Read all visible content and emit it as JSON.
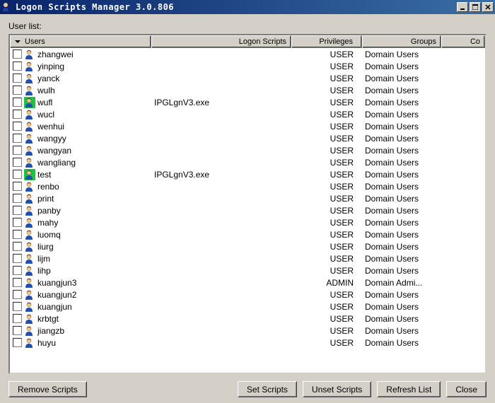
{
  "window": {
    "title": "Logon Scripts Manager 3.0.806"
  },
  "labels": {
    "user_list": "User list:"
  },
  "columns": {
    "users": "Users",
    "logon_scripts": "Logon Scripts",
    "privileges": "Privileges",
    "groups": "Groups",
    "co": "Co"
  },
  "rows": [
    {
      "user": "zhangwei",
      "script": "",
      "priv": "USER",
      "group": "Domain Users",
      "green": false
    },
    {
      "user": "yinping",
      "script": "",
      "priv": "USER",
      "group": "Domain Users",
      "green": false
    },
    {
      "user": "yanck",
      "script": "",
      "priv": "USER",
      "group": "Domain Users",
      "green": false
    },
    {
      "user": "wulh",
      "script": "",
      "priv": "USER",
      "group": "Domain Users",
      "green": false
    },
    {
      "user": "wufl",
      "script": "IPGLgnV3.exe",
      "priv": "USER",
      "group": "Domain Users",
      "green": true
    },
    {
      "user": "wucl",
      "script": "",
      "priv": "USER",
      "group": "Domain Users",
      "green": false
    },
    {
      "user": "wenhui",
      "script": "",
      "priv": "USER",
      "group": "Domain Users",
      "green": false
    },
    {
      "user": "wangyy",
      "script": "",
      "priv": "USER",
      "group": "Domain Users",
      "green": false
    },
    {
      "user": "wangyan",
      "script": "",
      "priv": "USER",
      "group": "Domain Users",
      "green": false
    },
    {
      "user": "wangliang",
      "script": "",
      "priv": "USER",
      "group": "Domain Users",
      "green": false
    },
    {
      "user": "test",
      "script": "IPGLgnV3.exe",
      "priv": "USER",
      "group": "Domain Users",
      "green": true
    },
    {
      "user": "renbo",
      "script": "",
      "priv": "USER",
      "group": "Domain Users",
      "green": false
    },
    {
      "user": "print",
      "script": "",
      "priv": "USER",
      "group": "Domain Users",
      "green": false
    },
    {
      "user": "panby",
      "script": "",
      "priv": "USER",
      "group": "Domain Users",
      "green": false
    },
    {
      "user": "mahy",
      "script": "",
      "priv": "USER",
      "group": "Domain Users",
      "green": false
    },
    {
      "user": "luomq",
      "script": "",
      "priv": "USER",
      "group": "Domain Users",
      "green": false
    },
    {
      "user": "liurg",
      "script": "",
      "priv": "USER",
      "group": "Domain Users",
      "green": false
    },
    {
      "user": "lijm",
      "script": "",
      "priv": "USER",
      "group": "Domain Users",
      "green": false
    },
    {
      "user": "lihp",
      "script": "",
      "priv": "USER",
      "group": "Domain Users",
      "green": false
    },
    {
      "user": "kuangjun3",
      "script": "",
      "priv": "ADMIN",
      "group": "Domain Admi...",
      "green": false
    },
    {
      "user": "kuangjun2",
      "script": "",
      "priv": "USER",
      "group": "Domain Users",
      "green": false
    },
    {
      "user": "kuangjun",
      "script": "",
      "priv": "USER",
      "group": "Domain Users",
      "green": false
    },
    {
      "user": "krbtgt",
      "script": "",
      "priv": "USER",
      "group": "Domain Users",
      "green": false
    },
    {
      "user": "jiangzb",
      "script": "",
      "priv": "USER",
      "group": "Domain Users",
      "green": false
    },
    {
      "user": "huyu",
      "script": "",
      "priv": "USER",
      "group": "Domain Users",
      "green": false
    }
  ],
  "buttons": {
    "remove": "Remove Scripts",
    "set": "Set Scripts",
    "unset": "Unset Scripts",
    "refresh": "Refresh List",
    "close": "Close"
  }
}
